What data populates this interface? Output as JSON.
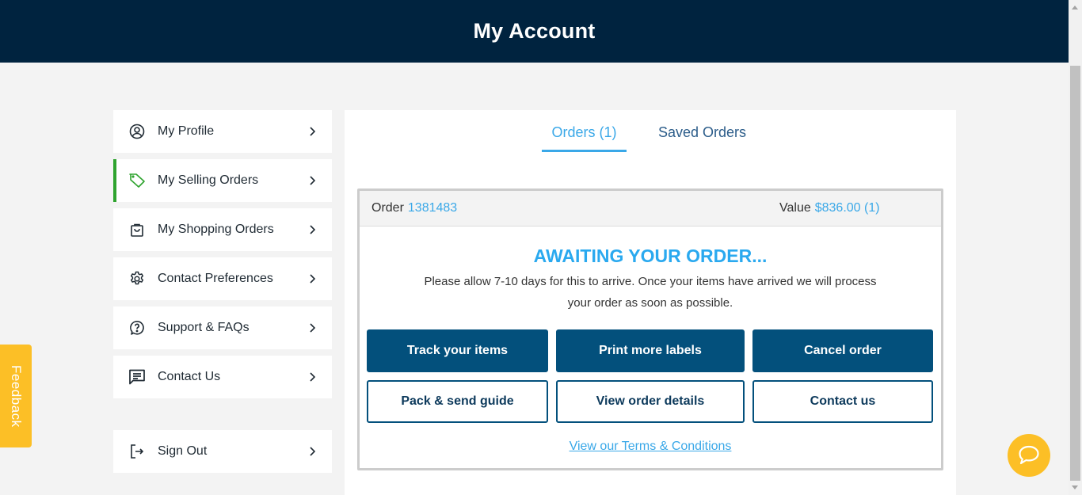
{
  "header": {
    "title": "My Account"
  },
  "sidebar": {
    "items": [
      {
        "label": "My Profile",
        "icon": "user-circle-icon",
        "active": false
      },
      {
        "label": "My Selling Orders",
        "icon": "tag-icon",
        "active": true
      },
      {
        "label": "My Shopping Orders",
        "icon": "shopping-bag-icon",
        "active": false
      },
      {
        "label": "Contact Preferences",
        "icon": "gear-icon",
        "active": false
      },
      {
        "label": "Support & FAQs",
        "icon": "question-bubble-icon",
        "active": false
      },
      {
        "label": "Contact Us",
        "icon": "message-icon",
        "active": false
      }
    ],
    "signout": {
      "label": "Sign Out",
      "icon": "sign-out-icon"
    }
  },
  "tabs": [
    {
      "label": "Orders (1)",
      "active": true
    },
    {
      "label": "Saved Orders",
      "active": false
    }
  ],
  "order": {
    "order_label": "Order",
    "order_number": "1381483",
    "value_label": "Value",
    "value": "$836.00 (1)",
    "status_title": "AWAITING YOUR ORDER...",
    "status_description": "Please allow 7-10 days for this to arrive. Once your items have arrived we will process your order as soon as possible.",
    "buttons": {
      "track": "Track your items",
      "print": "Print more labels",
      "cancel": "Cancel order",
      "guide": "Pack & send guide",
      "details": "View order details",
      "contact": "Contact us"
    },
    "terms_link": "View our Terms & Conditions"
  },
  "feedback": {
    "label": "Feedback"
  },
  "colors": {
    "header_bg": "#00233f",
    "accent_blue": "#3aa8e8",
    "primary_button": "#03507c",
    "active_green": "#2ea32e",
    "feedback_yellow": "#fcbf26"
  }
}
